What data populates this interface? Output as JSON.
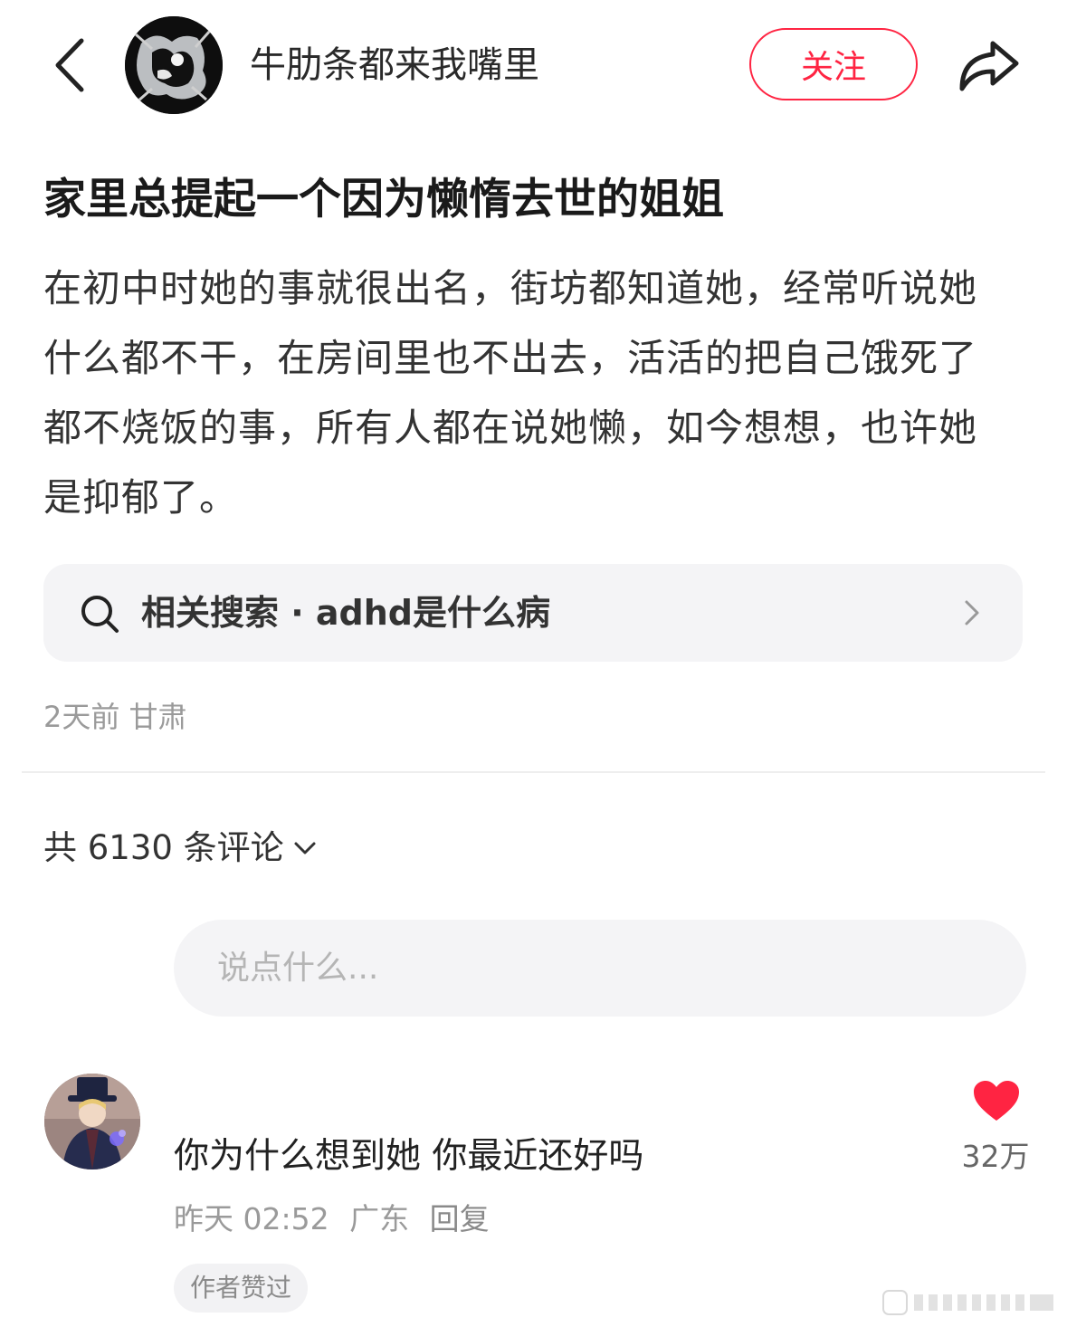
{
  "header": {
    "author_name": "牛肋条都来我嘴里",
    "follow_label": "关注",
    "back_icon": "chevron-left-icon",
    "share_icon": "share-arrow-icon"
  },
  "post": {
    "title": "家里总提起一个因为懒惰去世的姐姐",
    "body": "在初中时她的事就很出名，街坊都知道她，经常听说她什么都不干，在房间里也不出去，活活的把自己饿死了都不烧饭的事，所有人都在说她懒，如今想想，也许她是抑郁了。",
    "related_search": "相关搜索 · adhd是什么病",
    "meta": "2天前 甘肃"
  },
  "comments": {
    "count_label": "共 6130 条评论",
    "input_placeholder": "说点什么...",
    "items": [
      {
        "text": "你为什么想到她 你最近还好吗",
        "time": "昨天 02:52",
        "location": "广东",
        "reply_label": "回复",
        "badge": "作者赞过",
        "likes": "32万",
        "liked": true
      }
    ]
  },
  "colors": {
    "accent": "#ff2442",
    "muted_text": "#9a9a9a",
    "panel_bg": "#f4f4f6"
  }
}
